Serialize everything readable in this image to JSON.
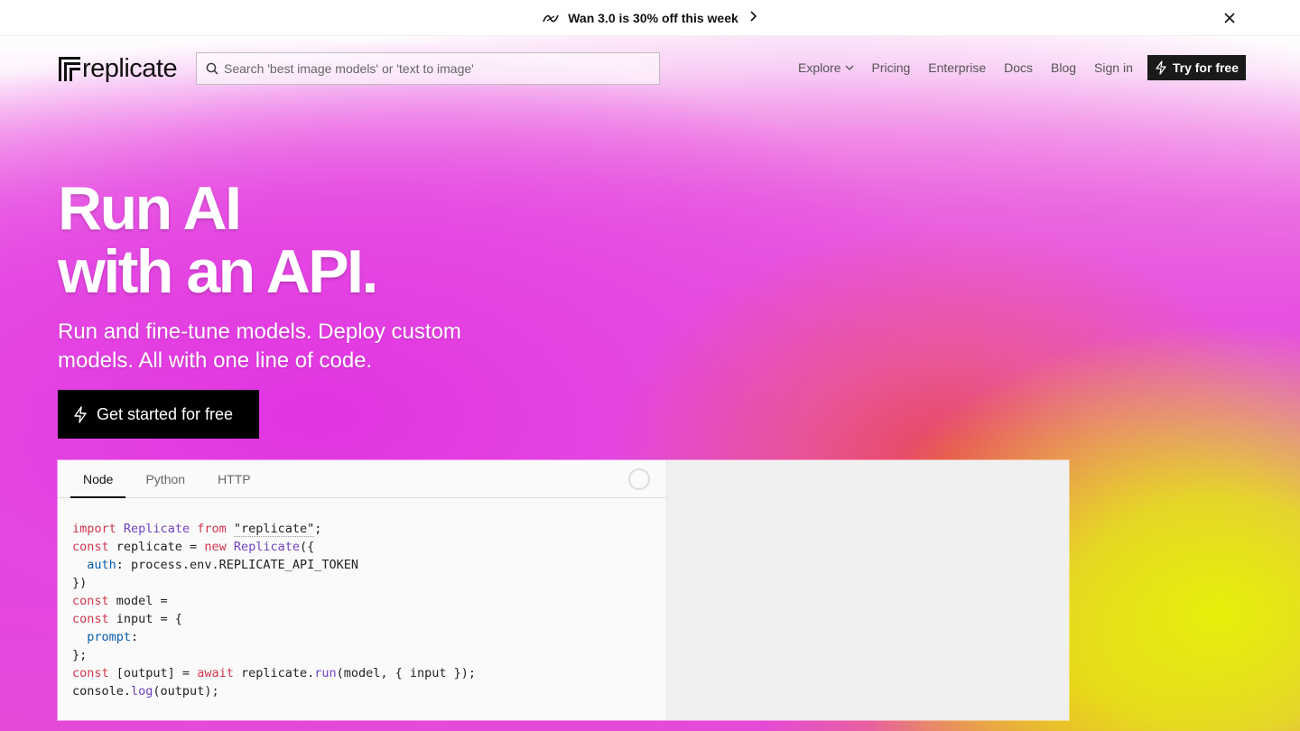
{
  "announcement": {
    "text": "Wan 3.0 is 30% off this week",
    "chevron": "›",
    "close_icon": "close-icon"
  },
  "nav": {
    "logo_text": "replicate",
    "search_placeholder": "Search 'best image models' or 'text to image'",
    "links": [
      "Explore",
      "Pricing",
      "Enterprise",
      "Docs",
      "Blog",
      "Sign in"
    ],
    "cta_label": "Try for free"
  },
  "hero": {
    "title_line1": "Run AI",
    "title_line2": "with an API.",
    "subtitle": "Run and fine-tune models. Deploy custom models. All with one line of code.",
    "cta_label": "Get started for free"
  },
  "code_panel": {
    "tabs": [
      "Node",
      "Python",
      "HTTP"
    ],
    "active_tab": "Node",
    "code": {
      "l1_kw": "import",
      "l1_cls": "Replicate",
      "l1_from": "from",
      "l1_str": "\"replicate\"",
      "l1_end": ";",
      "l2_kw": "const",
      "l2_mid": " replicate = ",
      "l2_new": "new",
      "l2_cls": "Replicate",
      "l2_end": "({",
      "l3_prop": "auth",
      "l3_rest": ": process.env.REPLICATE_API_TOKEN",
      "l4": "})",
      "l5_kw": "const",
      "l5_rest": " model =",
      "l6_kw": "const",
      "l6_rest": " input = {",
      "l7_prop": "prompt",
      "l7_rest": ":",
      "l8": "};",
      "l9_kw": "const",
      "l9_mid": " [output] = ",
      "l9_await": "await",
      "l9_obj": " replicate.",
      "l9_fn": "run",
      "l9_rest": "(model, { input });",
      "l10_obj": "console.",
      "l10_fn": "log",
      "l10_rest": "(output);"
    }
  },
  "colors": {
    "accent_dark": "#000000",
    "hero_magenta": "#e144dc",
    "hero_yellow": "#e6f00a",
    "hero_red": "#e84850",
    "keyword": "#d1364f",
    "class": "#6f42c1",
    "property": "#0b5cad"
  }
}
